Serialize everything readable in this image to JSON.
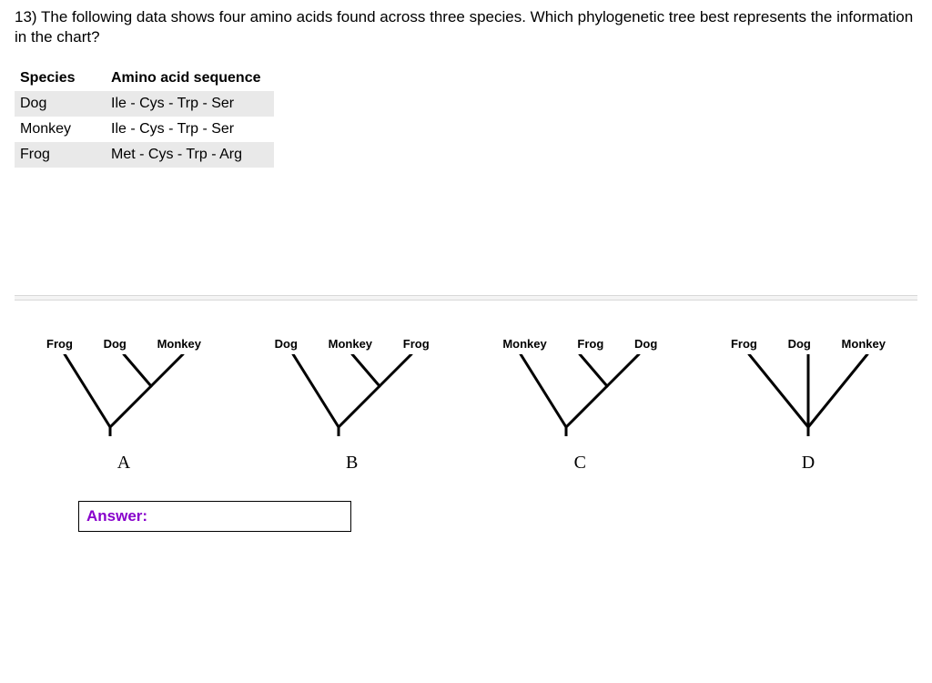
{
  "question": "13) The following data shows four amino acids found across three species. Which phylogenetic tree best represents the information in the chart?",
  "table": {
    "headers": [
      "Species",
      "Amino acid sequence"
    ],
    "rows": [
      {
        "species": "Dog",
        "sequence": "Ile - Cys - Trp - Ser"
      },
      {
        "species": "Monkey",
        "sequence": "Ile - Cys - Trp - Ser"
      },
      {
        "species": "Frog",
        "sequence": "Met - Cys - Trp - Arg"
      }
    ]
  },
  "options": [
    {
      "letter": "A",
      "taxa": [
        "Frog",
        "Dog",
        "Monkey"
      ],
      "topology": "right_pair"
    },
    {
      "letter": "B",
      "taxa": [
        "Dog",
        "Monkey",
        "Frog"
      ],
      "topology": "right_pair"
    },
    {
      "letter": "C",
      "taxa": [
        "Monkey",
        "Frog",
        "Dog"
      ],
      "topology": "right_pair"
    },
    {
      "letter": "D",
      "taxa": [
        "Frog",
        "Dog",
        "Monkey"
      ],
      "topology": "polytomy"
    }
  ],
  "answer_label": "Answer:"
}
